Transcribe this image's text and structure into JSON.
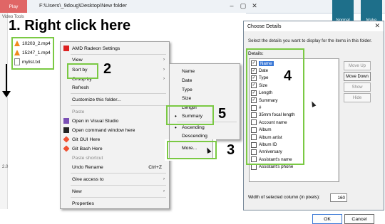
{
  "titlebar": {
    "play_label": "Play",
    "path": "F:\\Users\\_9doug\\Desktop\\New folder",
    "video_tools": "Video Tools"
  },
  "files": [
    {
      "name": "10203_2.mp4",
      "icon": "vlc-icon"
    },
    {
      "name": "15247_1.mp4",
      "icon": "vlc-icon"
    },
    {
      "name": "mylist.txt",
      "icon": "text-file-icon"
    }
  ],
  "steps": {
    "s1": "1. Right click here",
    "s2": "2",
    "s3": "3",
    "s4": "4",
    "s5": "5"
  },
  "left_margin_value": "2.0",
  "context_menu": {
    "items": [
      {
        "label": "AMD Radeon Settings",
        "icon": "amd-icon"
      },
      {
        "label": "View",
        "arrow": "›"
      },
      {
        "label": "Sort by",
        "arrow": "›"
      },
      {
        "label": "Group by",
        "arrow": "›"
      },
      {
        "label": "Refresh"
      },
      {
        "label": "Customize this folder..."
      },
      {
        "label": "Paste",
        "disabled": true
      },
      {
        "label": "Open in Visual Studio",
        "icon": "visual-studio-icon"
      },
      {
        "label": "Open command window here",
        "icon": "command-window-icon"
      },
      {
        "label": "Git GUI Here",
        "icon": "git-gui-icon"
      },
      {
        "label": "Git Bash Here",
        "icon": "git-bash-icon"
      },
      {
        "label": "Paste shortcut",
        "disabled": true
      },
      {
        "label": "Undo Rename",
        "shortcut": "Ctrl+Z"
      },
      {
        "label": "Give access to",
        "arrow": "›"
      },
      {
        "label": "New",
        "arrow": "›"
      },
      {
        "label": "Properties"
      }
    ]
  },
  "sort_submenu": {
    "items": [
      "Name",
      "Date",
      "Type",
      "Size",
      "Length",
      "Summary",
      "Ascending",
      "Descending",
      "More..."
    ],
    "bullet": "•"
  },
  "dialog": {
    "title": "Choose Details",
    "close": "✕",
    "description": "Select the details you want to display for the items in this folder.",
    "details_label": "Details:",
    "details": [
      {
        "label": "Name",
        "checked": true,
        "selected": true
      },
      {
        "label": "Date",
        "checked": true
      },
      {
        "label": "Type",
        "checked": true
      },
      {
        "label": "Size",
        "checked": true
      },
      {
        "label": "Length",
        "checked": true
      },
      {
        "label": "Summary",
        "checked": true
      },
      {
        "label": "#",
        "checked": false
      },
      {
        "label": "35mm focal length",
        "checked": false
      },
      {
        "label": "Account name",
        "checked": false
      },
      {
        "label": "Album",
        "checked": false
      },
      {
        "label": "Album artist",
        "checked": false
      },
      {
        "label": "Album ID",
        "checked": false
      },
      {
        "label": "Anniversary",
        "checked": false
      },
      {
        "label": "Assistant's name",
        "checked": false
      },
      {
        "label": "Assistant's phone",
        "checked": false
      }
    ],
    "check_mark": "✓",
    "buttons": {
      "move_up": "Move Up",
      "move_down": "Move Down",
      "show": "Show",
      "hide": "Hide"
    },
    "width_label": "Width of selected column (in pixels):",
    "width_value": "160",
    "ok": "OK",
    "cancel": "Cancel"
  },
  "desktop_icons": [
    {
      "label": "Normal"
    },
    {
      "label": "Make"
    }
  ]
}
